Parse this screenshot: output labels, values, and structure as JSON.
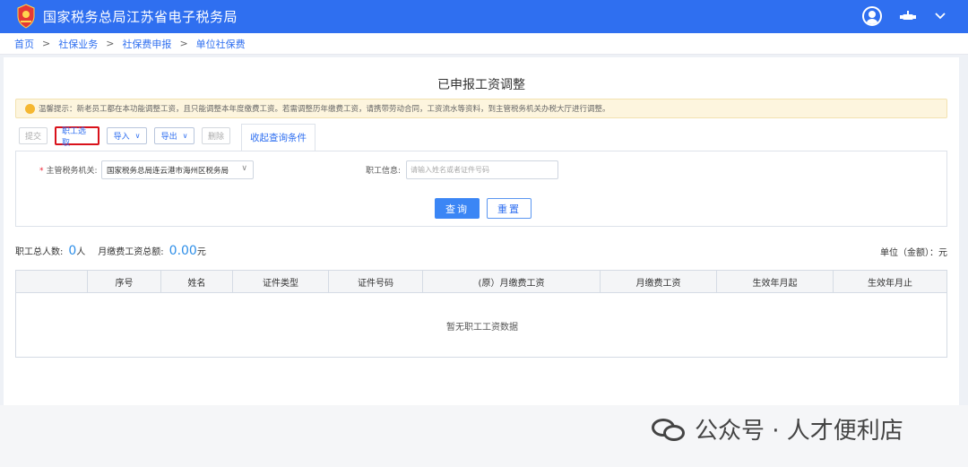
{
  "header": {
    "title": "国家税务总局江苏省电子税务局",
    "emblem_icon": "tax-emblem-icon",
    "user_icon": "user-circle-icon",
    "extra_icon": "robot-icon",
    "menu_icon": "chevron-down-icon",
    "bg_color": "#2f6ff0"
  },
  "breadcrumb": {
    "items": [
      "首页",
      "社保业务",
      "社保费申报",
      "单位社保费"
    ],
    "separator": ">"
  },
  "page": {
    "title": "已申报工资调整"
  },
  "tip": {
    "text": "温馨提示：新老员工都在本功能调整工资，且只能调整本年度缴费工资。若需调整历年缴费工资，请携带劳动合同，工资流水等资料，到主管税务机关办税大厅进行调整。"
  },
  "toolbar": {
    "submit": "提交",
    "select_staff": "职工选取",
    "import": "导入",
    "export": "导出",
    "delete": "删除",
    "collapse": "收起查询条件"
  },
  "query": {
    "tax_authority_label": "主管税务机关:",
    "tax_authority_value": "国家税务总局连云港市海州区税务局",
    "staff_info_label": "职工信息:",
    "staff_info_placeholder": "请输入姓名或者证件号码",
    "query_button": "查询",
    "reset_button": "重置"
  },
  "summary": {
    "total_label": "职工总人数:",
    "total_value": "0",
    "total_unit": "人",
    "amount_label": "月缴费工资总额:",
    "amount_value": "0.00",
    "amount_unit": "元",
    "unit_text": "单位（金额）：元"
  },
  "table": {
    "columns": [
      "",
      "序号",
      "姓名",
      "证件类型",
      "证件号码",
      "(原）月缴费工资",
      "月缴费工资",
      "生效年月起",
      "生效年月止"
    ],
    "empty_text": "暂无职工工资数据"
  },
  "watermark": {
    "text": "公众号 · 人才便利店",
    "icon": "wechat-icon"
  }
}
